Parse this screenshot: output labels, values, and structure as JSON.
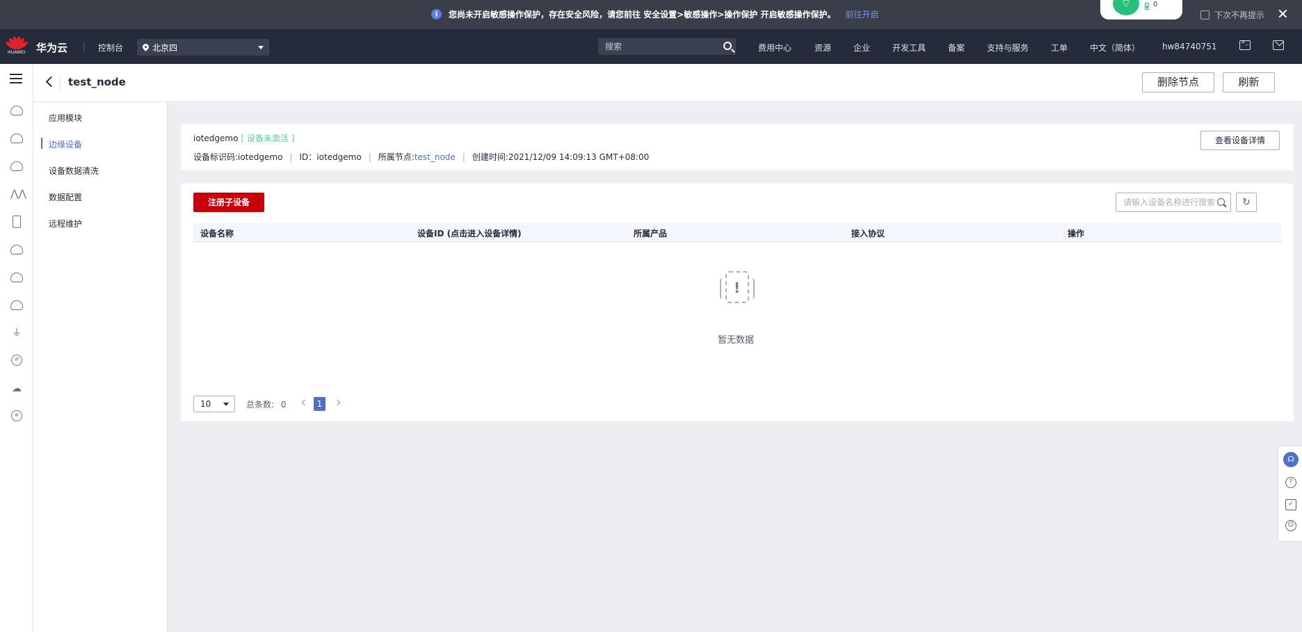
{
  "notice": {
    "message": "您尚未开启敏感操作保护，存在安全风险，请您前往 安全设置>敏感操作>操作保护 开启敏感操作保护。",
    "link": "前往开启",
    "dont_show": "下次不再提示",
    "wifi_count": "0"
  },
  "header": {
    "logo_caption": "HUAWEI",
    "brand": "华为云",
    "console": "控制台",
    "region": "北京四",
    "search_placeholder": "搜索",
    "nav": [
      "费用中心",
      "资源",
      "企业",
      "开发工具",
      "备案",
      "支持与服务",
      "工单",
      "中文（简体）",
      "hw84740751"
    ]
  },
  "sidebar": {
    "items": [
      {
        "label": "应用模块"
      },
      {
        "label": "边缘设备"
      },
      {
        "label": "设备数据清洗"
      },
      {
        "label": "数据配置"
      },
      {
        "label": "远程维护"
      }
    ]
  },
  "page": {
    "title": "test_node",
    "delete_btn": "删除节点",
    "refresh_btn": "刷新"
  },
  "device": {
    "name": "iotedgemo",
    "status": "[ 设备未激活 ]",
    "identifier_label": "设备标识码:",
    "identifier": "iotedgemo",
    "id_label": "ID：",
    "id": "iotedgemo",
    "node_label": "所属节点:",
    "node": "test_node",
    "created_label": "创建时间:",
    "created": "2021/12/09 14:09:13 GMT+08:00",
    "detail_btn": "查看设备详情"
  },
  "subdevices": {
    "register_btn": "注册子设备",
    "search_placeholder": "请输入设备名称进行搜索",
    "columns": [
      "设备名称",
      "设备ID (点击进入设备详情)",
      "所属产品",
      "接入协议",
      "操作"
    ],
    "rows": [],
    "empty_text": "暂无数据",
    "page_size": "10",
    "total_label": "总条数:",
    "total": "0",
    "current_page": "1"
  }
}
